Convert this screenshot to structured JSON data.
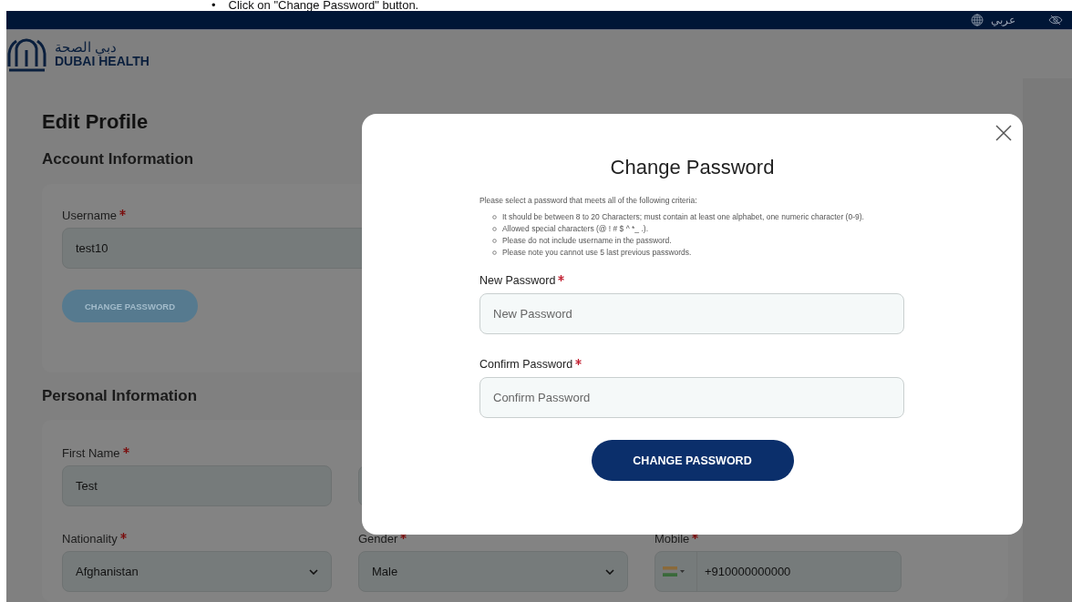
{
  "doc_note": {
    "bullet": "•",
    "text": "Click on \"Change Password\" button."
  },
  "top_bar": {
    "language": "عربي"
  },
  "brand": {
    "arabic": "دبي الصحة",
    "english": "DUBAI HEALTH"
  },
  "page": {
    "title": "Edit Profile",
    "account": {
      "heading": "Account Information",
      "username": {
        "label": "Username",
        "required": true,
        "value": "test10"
      },
      "button": {
        "label": "CHANGE PASSWORD",
        "disabled": true
      }
    },
    "personal": {
      "heading": "Personal Information",
      "rows": [
        [
          {
            "kind": "text",
            "label": "First Name",
            "required": true,
            "value": "Test"
          },
          {
            "kind": "hidden"
          }
        ],
        [
          {
            "kind": "select",
            "label": "Nationality",
            "required": true,
            "value": "Afghanistan"
          },
          {
            "kind": "select",
            "label": "Gender",
            "required": true,
            "value": "Male"
          },
          {
            "kind": "phone",
            "label": "Mobile",
            "required": true,
            "value": "+910000000000"
          }
        ]
      ]
    }
  },
  "modal": {
    "title": "Change Password",
    "intro": "Please select a password that meets all of the following criteria:",
    "criteria": [
      "It should be between 8 to 20 Characters; must contain at least one alphabet, one numeric character (0-9).",
      "Allowed special characters (@ ! # $ ^ *_ .).",
      "Please do not include username in the password.",
      "Please note you cannot use 5 last previous passwords."
    ],
    "fields": [
      {
        "label": "New Password",
        "required": true,
        "placeholder": "New Password"
      },
      {
        "label": "Confirm Password",
        "required": true,
        "placeholder": "Confirm Password"
      }
    ],
    "button": "CHANGE PASSWORD"
  }
}
